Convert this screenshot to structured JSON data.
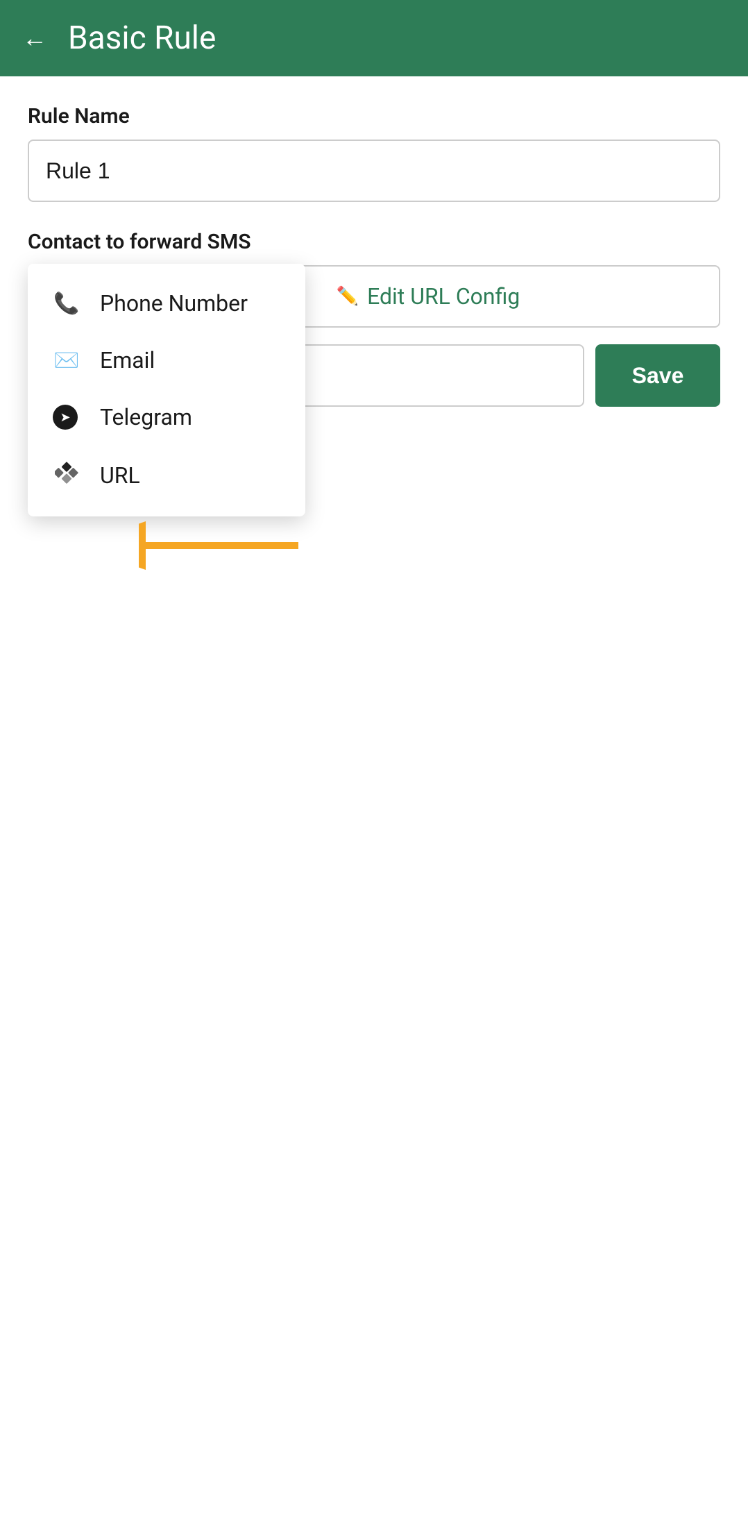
{
  "header": {
    "title": "Basic Rule",
    "back_label": "←"
  },
  "form": {
    "rule_name_label": "Rule Name",
    "rule_name_value": "Rule 1",
    "contact_label": "Contact to forward SMS",
    "edit_url_label": "Edit URL Config",
    "phone_input_placeholder": "Phone Number",
    "save_label": "Save"
  },
  "dropdown": {
    "items": [
      {
        "id": "phone",
        "label": "Phone Number",
        "icon": "phone"
      },
      {
        "id": "email",
        "label": "Email",
        "icon": "email"
      },
      {
        "id": "telegram",
        "label": "Telegram",
        "icon": "telegram"
      },
      {
        "id": "url",
        "label": "URL",
        "icon": "diamond"
      }
    ]
  },
  "colors": {
    "primary": "#2e7d57",
    "arrow": "#f5a623"
  }
}
